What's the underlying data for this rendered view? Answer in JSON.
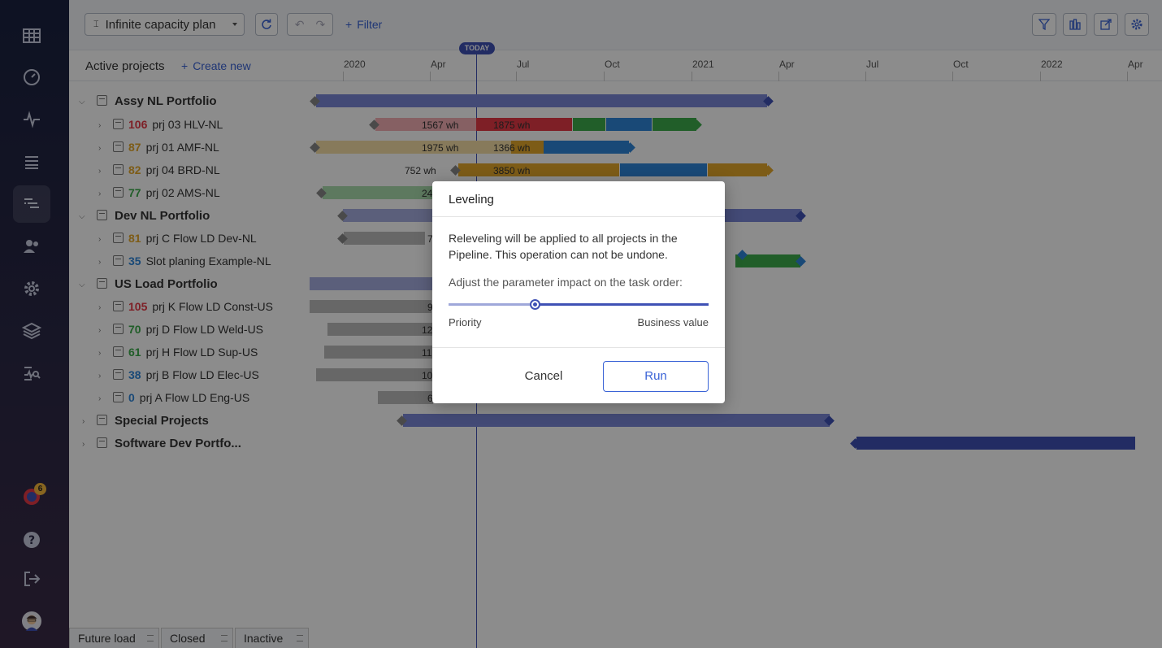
{
  "toolbar": {
    "plan_select": "Infinite capacity plan",
    "filter_label": "Filter"
  },
  "header": {
    "title": "Active projects",
    "create_new": "Create new",
    "today_label": "TODAY",
    "timeline_labels": [
      "2020",
      "Apr",
      "Jul",
      "Oct",
      "2021",
      "Apr",
      "Jul",
      "Oct",
      "2022",
      "Apr"
    ]
  },
  "rows": [
    {
      "type": "portfolio",
      "name": "Assy NL Portfolio",
      "expanded": true
    },
    {
      "type": "project",
      "num": "106",
      "num_color": "#e53946",
      "name": "prj 03 HLV-NL",
      "bar_labels": [
        "1567 wh",
        "1875 wh"
      ]
    },
    {
      "type": "project",
      "num": "87",
      "num_color": "#e3a82b",
      "name": "prj 01 AMF-NL",
      "bar_labels": [
        "1975 wh",
        "1366 wh"
      ]
    },
    {
      "type": "project",
      "num": "82",
      "num_color": "#e3a82b",
      "name": "prj 04 BRD-NL",
      "bar_labels": [
        "752 wh",
        "3850 wh"
      ]
    },
    {
      "type": "project",
      "num": "77",
      "num_color": "#3cab4c",
      "name": "prj 02 AMS-NL",
      "bar_labels": [
        "24"
      ]
    },
    {
      "type": "portfolio",
      "name": "Dev NL Portfolio",
      "expanded": true
    },
    {
      "type": "project",
      "num": "81",
      "num_color": "#e3a82b",
      "name": "prj C Flow LD Dev-NL",
      "bar_labels": [
        "7"
      ]
    },
    {
      "type": "project",
      "num": "35",
      "num_color": "#2f86d9",
      "name": "Slot planing Example-NL",
      "bar_labels": []
    },
    {
      "type": "portfolio",
      "name": "US Load Portfolio",
      "expanded": true
    },
    {
      "type": "project",
      "num": "105",
      "num_color": "#e53946",
      "name": "prj K Flow LD Const-US",
      "bar_labels": [
        "9"
      ]
    },
    {
      "type": "project",
      "num": "70",
      "num_color": "#3cab4c",
      "name": "prj D Flow LD Weld-US",
      "bar_labels": [
        "12"
      ]
    },
    {
      "type": "project",
      "num": "61",
      "num_color": "#3cab4c",
      "name": "prj H Flow LD Sup-US",
      "bar_labels": [
        "11"
      ]
    },
    {
      "type": "project",
      "num": "38",
      "num_color": "#2f86d9",
      "name": "prj B Flow LD Elec-US",
      "bar_labels": [
        "10"
      ]
    },
    {
      "type": "project",
      "num": "0",
      "num_color": "#2f86d9",
      "name": "prj A Flow LD Eng-US",
      "bar_labels": [
        "6"
      ]
    },
    {
      "type": "portfolio",
      "name": "Special Projects",
      "expanded": false
    },
    {
      "type": "portfolio",
      "name": "Software Dev Portfo...",
      "expanded": false
    }
  ],
  "bottom_tabs": [
    "Future load",
    "Closed",
    "Inactive"
  ],
  "sidebar": {
    "notification_count": "6"
  },
  "dialog": {
    "title": "Leveling",
    "body": "Releveling will be applied to all projects in the Pipeline. This operation can not be undone.",
    "adjust_label": "Adjust the parameter impact on the task order:",
    "slider_value": 0.33,
    "left_label": "Priority",
    "right_label": "Business value",
    "cancel_label": "Cancel",
    "run_label": "Run"
  }
}
